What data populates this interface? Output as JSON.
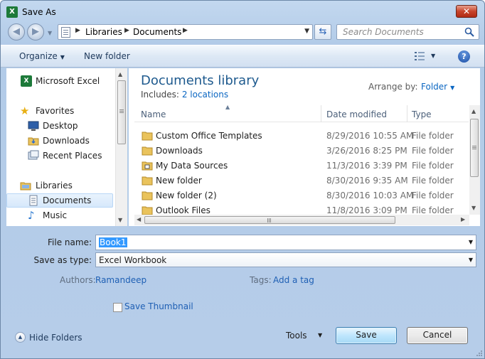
{
  "window": {
    "title": "Save As",
    "app_icon": "excel-icon"
  },
  "navigation": {
    "breadcrumbs": [
      "Libraries",
      "Documents"
    ],
    "search_placeholder": "Search Documents"
  },
  "toolbar": {
    "organize_label": "Organize",
    "new_folder_label": "New folder"
  },
  "sidebar": {
    "items": [
      {
        "label": "Microsoft Excel",
        "icon": "excel-icon"
      },
      {
        "label": "Favorites",
        "icon": "star-icon"
      },
      {
        "label": "Desktop",
        "icon": "desktop-icon"
      },
      {
        "label": "Downloads",
        "icon": "downloads-folder-icon"
      },
      {
        "label": "Recent Places",
        "icon": "recent-places-icon"
      },
      {
        "label": "Libraries",
        "icon": "libraries-icon"
      },
      {
        "label": "Documents",
        "icon": "document-icon",
        "selected": true
      },
      {
        "label": "Music",
        "icon": "music-note-icon"
      }
    ]
  },
  "library": {
    "title": "Documents library",
    "includes_label": "Includes:",
    "includes_link": "2 locations",
    "arrange_label": "Arrange by:",
    "arrange_value": "Folder"
  },
  "file_list": {
    "columns": [
      "Name",
      "Date modified",
      "Type"
    ],
    "rows": [
      {
        "name": "Custom Office Templates",
        "date": "8/29/2016 10:55 AM",
        "type": "File folder",
        "icon": "folder-icon"
      },
      {
        "name": "Downloads",
        "date": "3/26/2016 8:25 PM",
        "type": "File folder",
        "icon": "folder-icon"
      },
      {
        "name": "My Data Sources",
        "date": "11/3/2016 3:39 PM",
        "type": "File folder",
        "icon": "data-sources-folder-icon"
      },
      {
        "name": "New folder",
        "date": "8/30/2016 9:35 AM",
        "type": "File folder",
        "icon": "folder-icon"
      },
      {
        "name": "New folder (2)",
        "date": "8/30/2016 10:03 AM",
        "type": "File folder",
        "icon": "folder-icon"
      },
      {
        "name": "Outlook Files",
        "date": "11/8/2016 3:09 PM",
        "type": "File folder",
        "icon": "folder-icon"
      }
    ]
  },
  "form": {
    "file_name_label": "File name:",
    "file_name_value": "Book1",
    "save_as_type_label": "Save as type:",
    "save_as_type_value": "Excel Workbook",
    "authors_label": "Authors:",
    "authors_value": "Ramandeep",
    "tags_label": "Tags:",
    "tags_value": "Add a tag",
    "save_thumbnail_label": "Save Thumbnail",
    "save_thumbnail_checked": false
  },
  "footer": {
    "hide_folders_label": "Hide Folders",
    "tools_label": "Tools",
    "save_label": "Save",
    "cancel_label": "Cancel"
  },
  "colors": {
    "accent_link": "#0a66c2",
    "library_title": "#1e5a8e",
    "selection": "#3399ff",
    "close_button": "#c7432a"
  }
}
